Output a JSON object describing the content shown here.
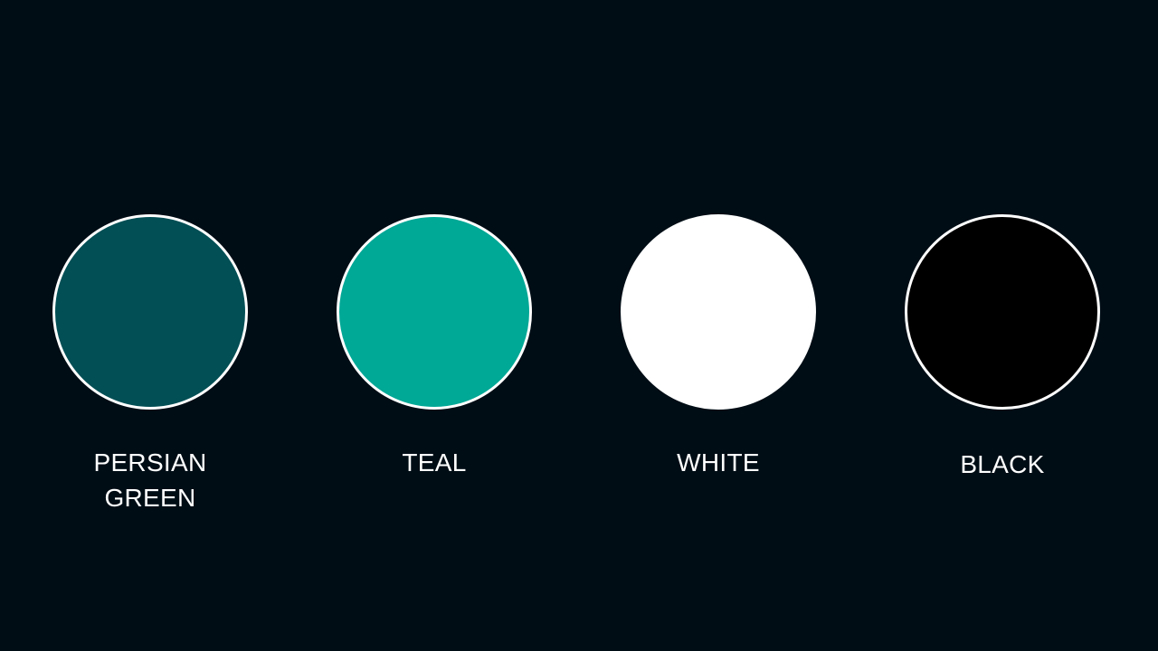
{
  "swatches": [
    {
      "label_lines": [
        "PERSIAN",
        "GREEN"
      ],
      "fill": "#024f55",
      "border": "#ffffff"
    },
    {
      "label_lines": [
        "TEAL"
      ],
      "fill": "#00a896",
      "border": "#ffffff"
    },
    {
      "label_lines": [
        "WHITE"
      ],
      "fill": "#ffffff",
      "border": "#ffffff"
    },
    {
      "label_lines": [
        "BLACK"
      ],
      "fill": "#000000",
      "border": "#ffffff"
    }
  ],
  "colors": {
    "background": "#000d15",
    "text": "#ffffff"
  }
}
